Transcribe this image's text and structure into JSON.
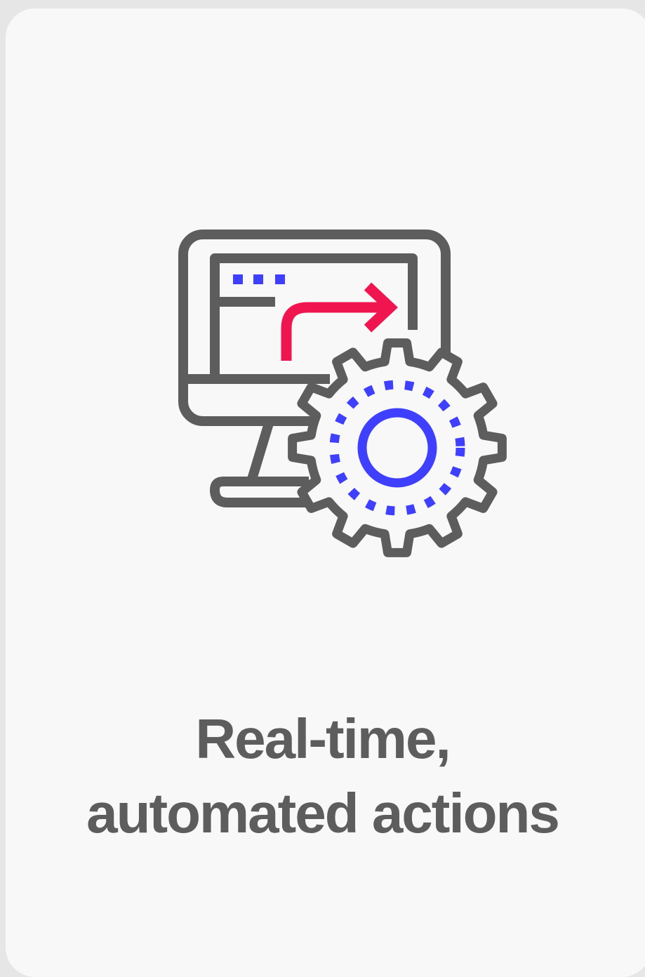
{
  "card": {
    "title_line1": "Real-time,",
    "title_line2": "automated actions"
  },
  "icon": {
    "name": "monitor-gear-automation-icon",
    "colors": {
      "outline": "#5d5d5d",
      "accent_blue": "#3f3fff",
      "accent_red": "#f0154f",
      "fill": "#ffffff"
    }
  },
  "colors": {
    "page_background": "#e6e6e6",
    "card_background": "#f8f8f8",
    "text": "#5d5d5d"
  }
}
